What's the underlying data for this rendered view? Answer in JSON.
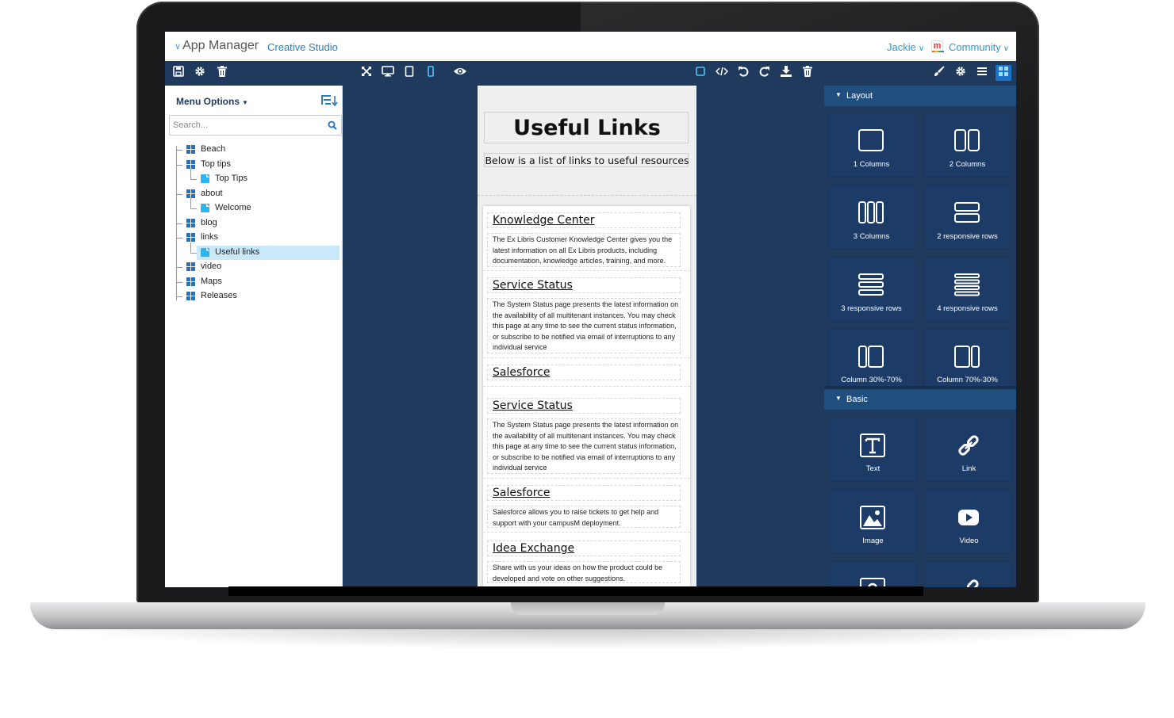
{
  "app": {
    "title": "App Manager",
    "subtitle": "Creative Studio",
    "user": "Jackie",
    "community": "Community",
    "community_logo": "m"
  },
  "toolbar": {
    "left_icons": [
      "save-icon",
      "gear-icon",
      "trash-icon"
    ],
    "center_icons": [
      "fullscreen-icon",
      "desktop-icon",
      "tablet-icon",
      "mobile-icon",
      "eye-icon"
    ],
    "edit_icons": [
      "select-box-icon",
      "code-icon",
      "undo-icon",
      "redo-icon",
      "download-icon",
      "trash-icon"
    ],
    "right_icons": [
      "brush-icon",
      "gear-icon",
      "hamburger-icon",
      "blocks-grid-icon"
    ]
  },
  "sidebar": {
    "menu_label": "Menu Options",
    "search_placeholder": "Search...",
    "items": [
      {
        "label": "Beach",
        "type": "section",
        "indent": 0
      },
      {
        "label": "Top tips",
        "type": "section",
        "indent": 0
      },
      {
        "label": "Top Tips",
        "type": "page",
        "indent": 1
      },
      {
        "label": "about",
        "type": "section",
        "indent": 0
      },
      {
        "label": "Welcome",
        "type": "page",
        "indent": 1
      },
      {
        "label": "blog",
        "type": "section",
        "indent": 0
      },
      {
        "label": "links",
        "type": "section",
        "indent": 0
      },
      {
        "label": "Useful links",
        "type": "page",
        "indent": 1,
        "selected": true
      },
      {
        "label": "video",
        "type": "section",
        "indent": 0
      },
      {
        "label": "Maps",
        "type": "section",
        "indent": 0
      },
      {
        "label": "Releases",
        "type": "section",
        "indent": 0
      }
    ]
  },
  "canvas": {
    "title": "Useful Links",
    "subtitle": "Below is a list of links to useful resources",
    "cards": [
      {
        "title": "Knowledge Center",
        "body": "The Ex Libris Customer Knowledge Center gives you the latest information on all Ex Libris products, including documentation, knowledge articles, training, and more."
      },
      {
        "title": "Service Status",
        "body": "The System Status page presents the latest information on the availability of all multitenant instances. You may check this page at any time to see the current status information, or subscribe to be notified via email of interruptions to any individual service"
      },
      {
        "title": "Salesforce",
        "body": ""
      },
      {
        "title": "Service Status",
        "body": "The System Status page presents the latest information on the availability of all multitenant instances. You may check this page at any time to see the current status information, or subscribe to be notified via email of interruptions to any individual service"
      },
      {
        "title": "Salesforce",
        "body": "Salesforce allows you to raise tickets to get help and support with your campusM deployment."
      },
      {
        "title": "Idea Exchange",
        "body": "Share with us your ideas on how the product could be developed and vote on other suggestions."
      }
    ]
  },
  "blocks": {
    "layout_label": "Layout",
    "basic_label": "Basic",
    "layout": [
      "1 Columns",
      "2 Columns",
      "3 Columns",
      "2 responsive rows",
      "3 responsive rows",
      "4 responsive rows",
      "Column 30%-70%",
      "Column 70%-30%"
    ],
    "basic": [
      "Text",
      "Link",
      "Image",
      "Video"
    ]
  },
  "colors": {
    "toolbar": "#1f3a5c",
    "panel": "#1f3a5c",
    "block": "#1c3c67",
    "accent": "#2a9ad6",
    "selected": "#c9e9fb"
  }
}
